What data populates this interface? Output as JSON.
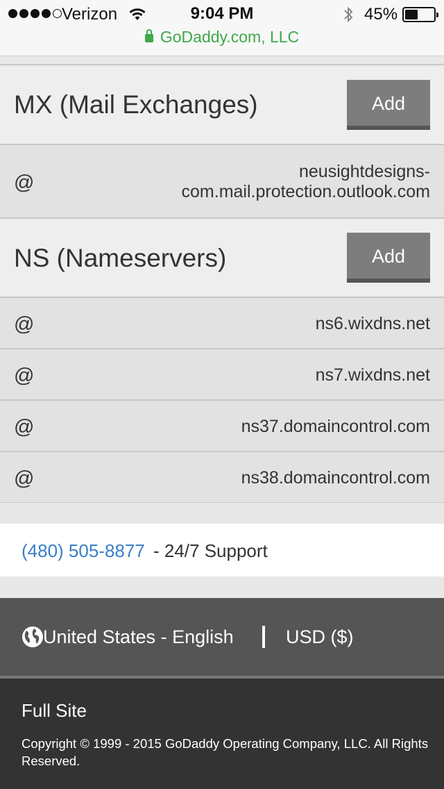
{
  "status_bar": {
    "carrier": "Verizon",
    "time": "9:04 PM",
    "battery_percent": "45%",
    "battery_level": 0.45,
    "signal_bars_filled": 4,
    "signal_bars_total": 5,
    "icons": [
      "signal-icon",
      "wifi-icon",
      "bluetooth-icon",
      "battery-icon"
    ]
  },
  "url_bar": {
    "site_identity": "GoDaddy.com, LLC",
    "secure_color": "#3ea84a"
  },
  "mx_section": {
    "title": "MX (Mail Exchanges)",
    "add_label": "Add",
    "records": [
      {
        "host": "@",
        "value_line1": "neusightdesigns-",
        "value_line2": "com.mail.protection.outlook.com"
      }
    ]
  },
  "ns_section": {
    "title": "NS (Nameservers)",
    "add_label": "Add",
    "records": [
      {
        "host": "@",
        "value": "ns6.wixdns.net"
      },
      {
        "host": "@",
        "value": "ns7.wixdns.net"
      },
      {
        "host": "@",
        "value": "ns37.domaincontrol.com"
      },
      {
        "host": "@",
        "value": "ns38.domaincontrol.com"
      }
    ]
  },
  "support": {
    "phone": "(480) 505-8877",
    "label": "- 24/7 Support",
    "link_color": "#3a7fc8"
  },
  "locale_bar": {
    "locale": "United States - English",
    "currency": "USD ($)",
    "icon": "globe-icon"
  },
  "footer": {
    "full_site": "Full Site",
    "copyright": "Copyright © 1999 - 2015 GoDaddy Operating Company, LLC. All Rights Reserved."
  }
}
